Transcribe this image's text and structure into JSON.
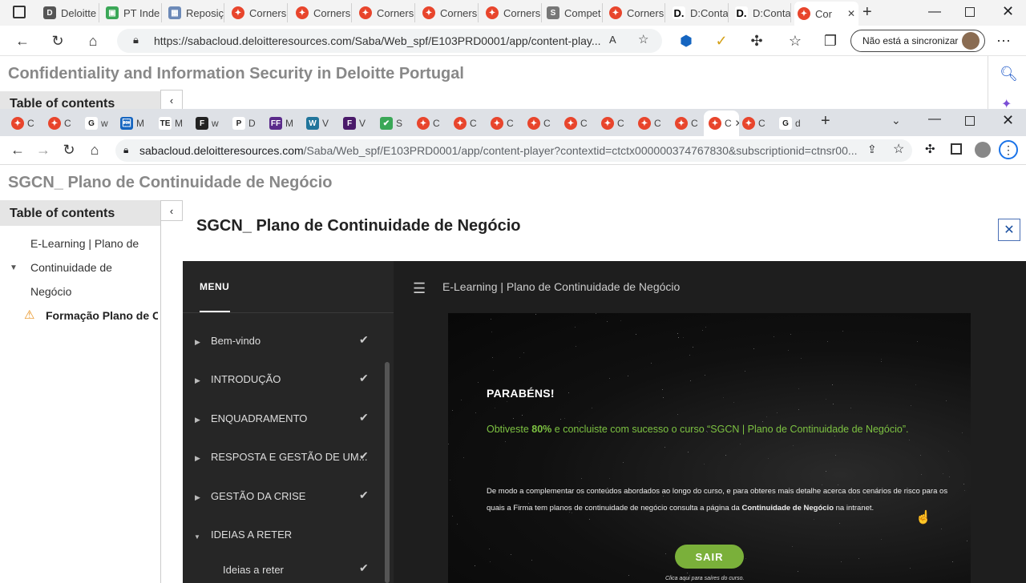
{
  "edge": {
    "tabs": [
      {
        "label": "Deloitte",
        "icon": "deloitte-d-icon"
      },
      {
        "label": "PT Inde",
        "icon": "green-app-icon"
      },
      {
        "label": "Reposiç",
        "icon": "image-icon"
      },
      {
        "label": "Corners",
        "icon": "cornerstone-icon"
      },
      {
        "label": "Corners",
        "icon": "cornerstone-icon"
      },
      {
        "label": "Corners",
        "icon": "cornerstone-icon"
      },
      {
        "label": "Corners",
        "icon": "cornerstone-icon"
      },
      {
        "label": "Corners",
        "icon": "cornerstone-icon"
      },
      {
        "label": "Compet",
        "icon": "s-app-icon"
      },
      {
        "label": "Corners",
        "icon": "cornerstone-icon"
      },
      {
        "label": "D:Conta",
        "icon": "deloitte-black-icon"
      },
      {
        "label": "D:Conta",
        "icon": "deloitte-black-icon"
      },
      {
        "label": "Cor",
        "icon": "cornerstone-icon",
        "active": true
      }
    ],
    "url": "https://sabacloud.deloitteresources.com/Saba/Web_spf/E103PRD0001/app/content-play...",
    "sync_label": "Não está a sincronizar"
  },
  "back_page": {
    "title": "Confidentiality and Information Security in Deloitte Portugal",
    "toc_label": "Table of contents"
  },
  "chrome": {
    "tabs": [
      {
        "label": "C",
        "icon": "cornerstone-icon"
      },
      {
        "label": "C",
        "icon": "cornerstone-icon"
      },
      {
        "label": "w",
        "icon": "google-icon"
      },
      {
        "label": "M",
        "icon": "blue-app-icon"
      },
      {
        "label": "M",
        "icon": "te-icon"
      },
      {
        "label": "w",
        "icon": "f-icon"
      },
      {
        "label": "D",
        "icon": "p-icon"
      },
      {
        "label": "M",
        "icon": "ff-icon"
      },
      {
        "label": "V",
        "icon": "wordpress-icon"
      },
      {
        "label": "V",
        "icon": "purple-f-icon"
      },
      {
        "label": "S",
        "icon": "shield-icon"
      },
      {
        "label": "C",
        "icon": "cornerstone-icon"
      },
      {
        "label": "C",
        "icon": "cornerstone-icon"
      },
      {
        "label": "C",
        "icon": "cornerstone-icon"
      },
      {
        "label": "C",
        "icon": "cornerstone-icon"
      },
      {
        "label": "C",
        "icon": "cornerstone-icon"
      },
      {
        "label": "C",
        "icon": "cornerstone-icon"
      },
      {
        "label": "C",
        "icon": "cornerstone-icon"
      },
      {
        "label": "C",
        "icon": "cornerstone-icon"
      },
      {
        "label": "C",
        "icon": "cornerstone-icon",
        "active": true
      },
      {
        "label": "C",
        "icon": "cornerstone-icon"
      },
      {
        "label": "d",
        "icon": "google-icon"
      }
    ],
    "url_host": "sabacloud.deloitteresources.com",
    "url_path": "/Saba/Web_spf/E103PRD0001/app/content-player?contextid=ctctx000000374767830&subscriptionid=ctnsr00..."
  },
  "page": {
    "title": "SGCN_ Plano de Continuidade de Negócio",
    "toc_label": "Table of contents",
    "toc": {
      "item1_line1": "E-Learning | Plano de",
      "item1_line2": "Continuidade de",
      "item1_line3": "Negócio",
      "child": "Formação Plano de Co"
    },
    "modal_title": "SGCN_ Plano de Continuidade de Negócio"
  },
  "player": {
    "menu_label": "MENU",
    "breadcrumb": "E-Learning | Plano de Continuidade de Negócio",
    "menu_items": [
      {
        "label": "Bem-vindo",
        "done": true
      },
      {
        "label": "INTRODUÇÃO",
        "done": true
      },
      {
        "label": "ENQUADRAMENTO",
        "done": true
      },
      {
        "label": "RESPOSTA E GESTÃO DE UM...",
        "done": true
      },
      {
        "label": "GESTÃO DA CRISE",
        "done": true
      },
      {
        "label": "IDEIAS A RETER",
        "expanded": true
      }
    ],
    "sub_item": "Ideias a reter",
    "slide": {
      "heading": "PARABÉNS!",
      "result_pre": "Obtiveste ",
      "result_pct": "80%",
      "result_post": " e concluiste com sucesso o curso “SGCN | Plano de Continuidade de Negócio”.",
      "body_pre": "De modo a complementar os conteúdos abordados ao longo do curso, e para obteres mais detalhe acerca dos cenários de risco para os quais a Firma tem planos de continuidade de negócio consulta a página da ",
      "body_bold": "Continuidade de Negócio",
      "body_post": " na intranet.",
      "exit_button": "SAIR",
      "exit_note": "Clica aqui para saíres do curso."
    }
  },
  "colors": {
    "accent_green": "#7ab03a",
    "result_green": "#7dc242",
    "player_bg": "#1e1e1e",
    "close_blue": "#1a4fa0"
  }
}
